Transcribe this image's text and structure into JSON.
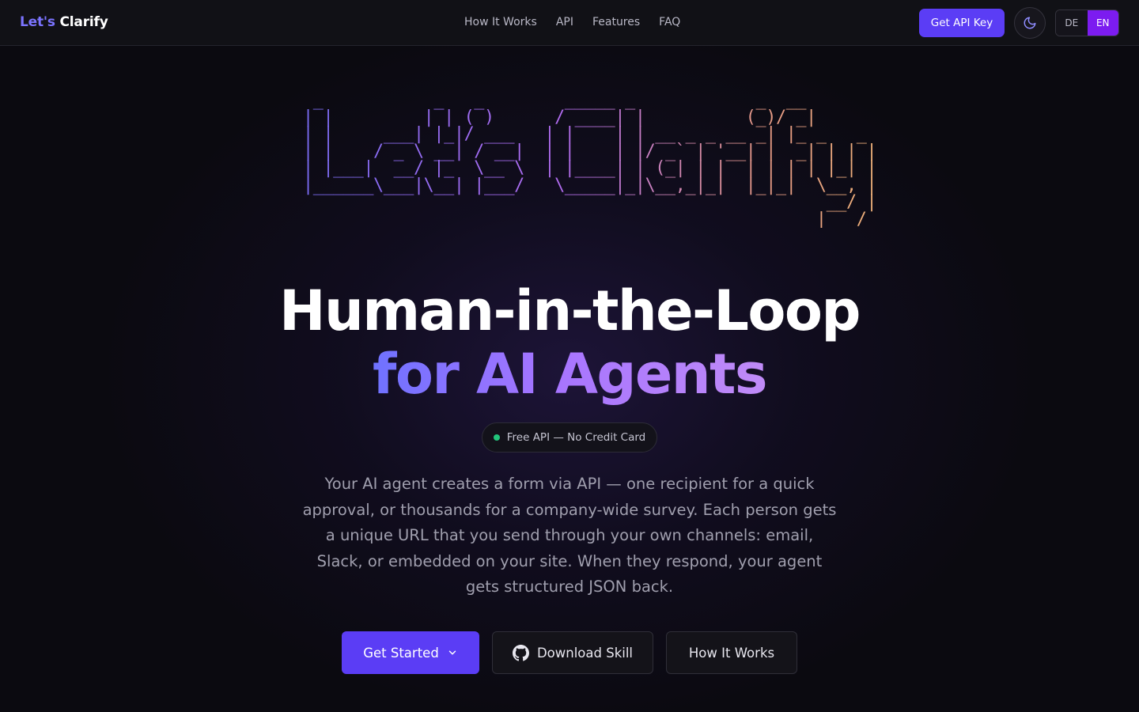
{
  "nav": {
    "logo_part1": "Let's",
    "logo_part2": "Clarify",
    "links": [
      "How It Works",
      "API",
      "Features",
      "FAQ"
    ],
    "api_key_button": "Get API Key",
    "theme_toggle_icon": "moon-icon",
    "languages": [
      "DE",
      "EN"
    ],
    "active_language": "EN"
  },
  "hero": {
    "ascii_art": " _           _   _        _____ _            _  __\n| |         | | ( )      / ____| |          (_)/ _|\n| |     ___| |_|/ ___   | |    | | __ _ _ __ _| |_ _   _\n| |    / _ \\ __| / __|  | |    | |/ _` | '__| |  _| | | |\n| |___|  __/ |_  \\__ \\  | |____| | (_| | |  | | | | |_| |\n|______\\___|\\__| |___/   \\_____|_|\\__,_|_|  |_|_|  \\__, |\n                                                    __/ |\n                                                   |___/",
    "title_line1": "Human-in-the-Loop",
    "title_line2": "for AI Agents",
    "badge": "Free API — No Credit Card",
    "description": "Your AI agent creates a form via API — one recipient for a quick approval, or thousands for a company-wide survey. Each person gets a unique URL that you send through your own channels: email, Slack, or embedded on your site. When they respond, your agent gets structured JSON back.",
    "buttons": {
      "get_started": "Get Started",
      "download_skill": "Download Skill",
      "how_it_works": "How It Works"
    }
  },
  "colors": {
    "accent": "#5b3df5",
    "background": "#0b0a10",
    "badge_dot": "#22c47a",
    "active_lang": "#7c1cf0"
  }
}
